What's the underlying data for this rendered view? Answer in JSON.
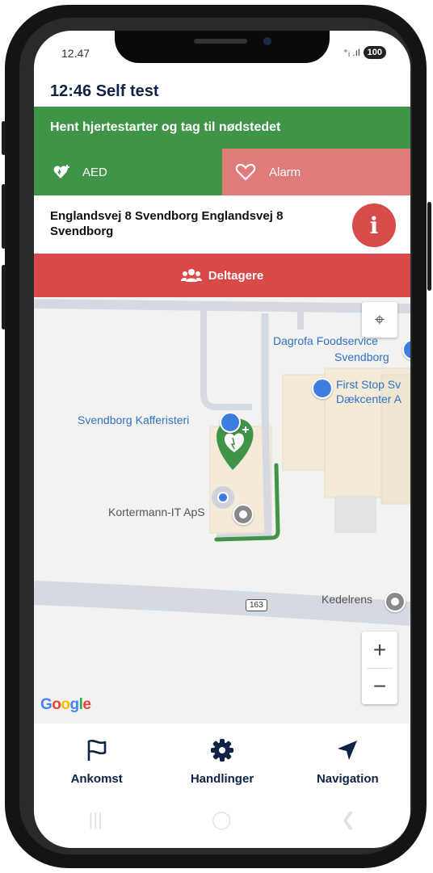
{
  "status_bar": {
    "time": "12.47",
    "battery": "100",
    "signal": "⁺ᵢ .ıl"
  },
  "header": {
    "title": "12:46 Self test"
  },
  "banner": {
    "text": "Hent hjertestarter og tag til nødstedet"
  },
  "tabs": [
    {
      "label": "AED",
      "icon": "heart-plus-icon"
    },
    {
      "label": "Alarm",
      "icon": "heart-outline-icon"
    }
  ],
  "address": {
    "text": "Englandsvej 8 Svendborg Englandsvej 8 Svendborg",
    "info_icon": "i"
  },
  "participants": {
    "label": "Deltagere",
    "icon": "users-icon"
  },
  "map": {
    "labels": {
      "dagrofa": "Dagrofa Foodservice",
      "dagrofa_city": "Svendborg",
      "firststop_1": "First Stop Sv",
      "firststop_2": "Dækcenter A",
      "kafferi": "Svendborg Kafferisteri",
      "kortermann": "Kortermann-IT ApS",
      "kedelrens": "Kedelrens",
      "road_number": "163"
    },
    "attribution": [
      "G",
      "o",
      "o",
      "g",
      "l",
      "e"
    ],
    "colors": {
      "route": "#3f9447",
      "marker": "#3f9447",
      "poi": "#3b7de0"
    },
    "zoom_in": "+",
    "zoom_out": "−"
  },
  "bottom_nav": [
    {
      "label": "Ankomst",
      "icon": "flag-icon"
    },
    {
      "label": "Handlinger",
      "icon": "gear-icon"
    },
    {
      "label": "Navigation",
      "icon": "navigation-arrow-icon"
    }
  ],
  "system_nav": {
    "recents": "|||",
    "home": "◯",
    "back": "❮"
  },
  "colors": {
    "green": "#3f9447",
    "red": "#d9494a",
    "pink": "#e07b7b",
    "navy": "#0d2244"
  }
}
